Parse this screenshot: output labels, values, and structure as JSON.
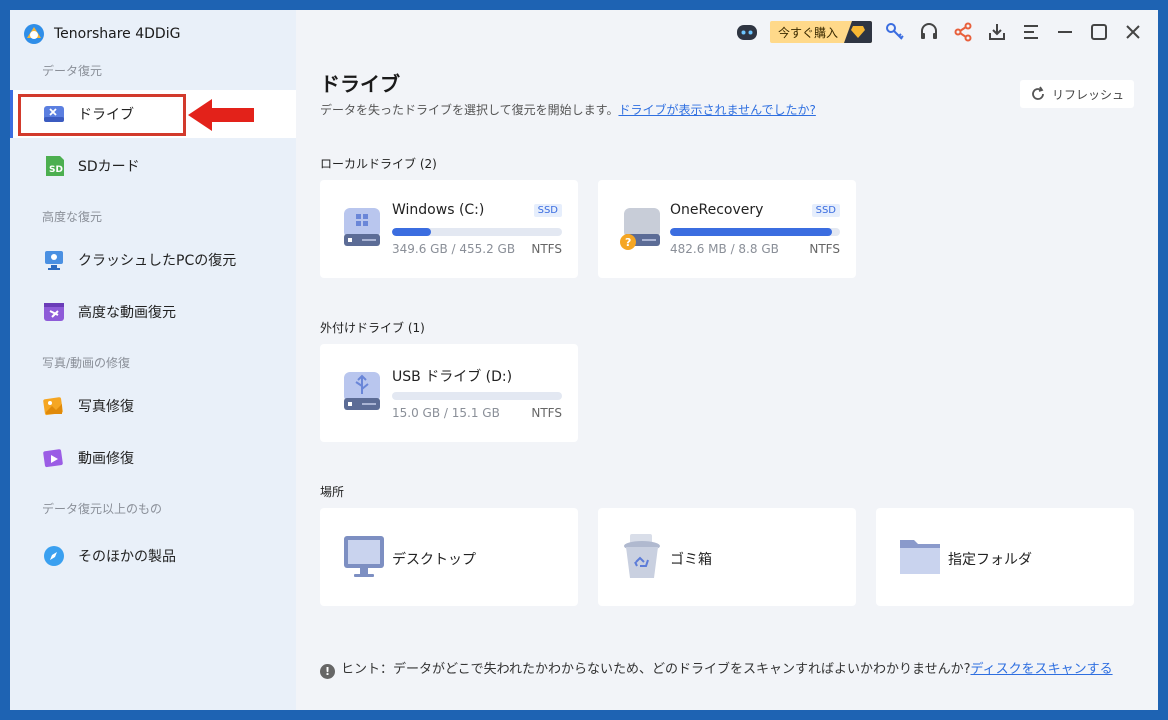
{
  "app": {
    "title": "Tenorshare 4DDiG"
  },
  "sidebar": {
    "sections": [
      {
        "label": "データ復元"
      },
      {
        "label": "高度な復元"
      },
      {
        "label": "写真/動画の修復"
      },
      {
        "label": "データ復元以上のもの"
      }
    ],
    "items": [
      {
        "label": "ドライブ",
        "icon": "drive-icon"
      },
      {
        "label": "SDカード",
        "icon": "sd-card-icon"
      },
      {
        "label": "クラッシュしたPCの復元",
        "icon": "crashed-pc-icon"
      },
      {
        "label": "高度な動画復元",
        "icon": "advanced-video-icon"
      },
      {
        "label": "写真修復",
        "icon": "photo-repair-icon"
      },
      {
        "label": "動画修復",
        "icon": "video-repair-icon"
      },
      {
        "label": "そのほかの製品",
        "icon": "compass-icon"
      }
    ]
  },
  "topbar": {
    "buy_label": "今すぐ購入"
  },
  "main": {
    "title": "ドライブ",
    "subtitle": "データを失ったドライブを選択して復元を開始します。",
    "subtitle_link": "ドライブが表示されませんでしたか?",
    "refresh_label": "リフレッシュ",
    "local_label": "ローカルドライブ (2)",
    "external_label": "外付けドライブ (1)",
    "locations_label": "場所",
    "local_drives": [
      {
        "name": "Windows (C:)",
        "badge": "SSD",
        "size": "349.6 GB / 455.2 GB",
        "fs": "NTFS",
        "usage": 0.23
      },
      {
        "name": "OneRecovery",
        "badge": "SSD",
        "size": "482.6 MB / 8.8 GB",
        "fs": "NTFS",
        "usage": 0.95
      }
    ],
    "external_drives": [
      {
        "name": "USB ドライブ (D:)",
        "size": "15.0 GB / 15.1 GB",
        "fs": "NTFS",
        "usage": 0.0
      }
    ],
    "locations": [
      {
        "label": "デスクトップ",
        "icon": "desktop-icon"
      },
      {
        "label": "ゴミ箱",
        "icon": "recycle-bin-icon"
      },
      {
        "label": "指定フォルダ",
        "icon": "folder-icon"
      }
    ],
    "hint_text": "ヒント：データがどこで失われたかわからないため、どのドライブをスキャンすればよいかわかりませんか?",
    "hint_link": "ディスクをスキャンする"
  },
  "colors": {
    "accent": "#3b6de0",
    "highlight": "#d23a2c",
    "sidebar_bg": "#e9f0f9"
  }
}
